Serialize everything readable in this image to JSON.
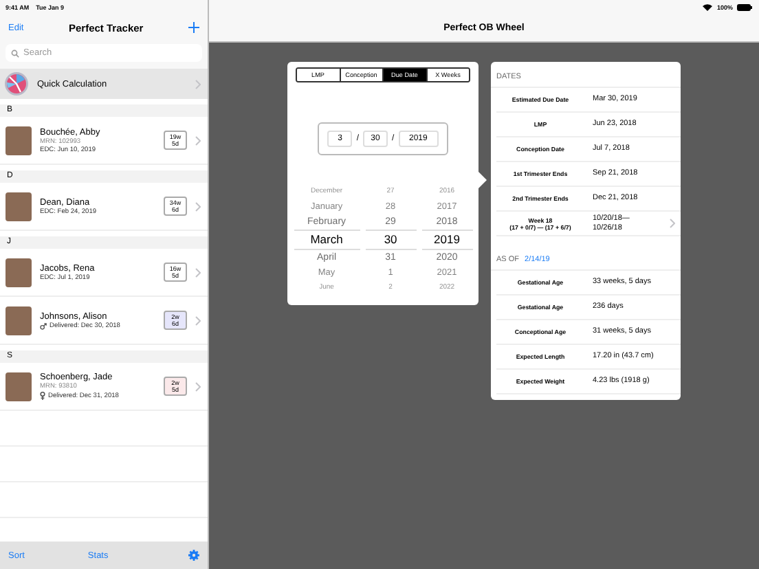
{
  "status_bar": {
    "time": "9:41 AM",
    "date": "Tue Jan 9",
    "battery": "100%"
  },
  "sidebar": {
    "edit": "Edit",
    "title": "Perfect Tracker",
    "search": {
      "placeholder": "Search"
    },
    "quick": {
      "label": "Quick Calculation",
      "selected": true
    },
    "sections": [
      {
        "letter": "B",
        "patients": [
          {
            "name": "Bouchée, Abby",
            "mrn": "MRN: 102993",
            "detail": "EDC: Jun 10, 2019",
            "kind": "edc",
            "badge": "19w\n5d",
            "color": "#ffffff"
          }
        ]
      },
      {
        "letter": "D",
        "patients": [
          {
            "name": "Dean, Diana",
            "detail": "EDC: Feb 24, 2019",
            "kind": "edc",
            "badge": "34w\n6d",
            "color": "#ffffff"
          }
        ]
      },
      {
        "letter": "J",
        "patients": [
          {
            "name": "Jacobs, Rena",
            "detail": "EDC: Jul 1, 2019",
            "kind": "edc",
            "badge": "16w\n5d",
            "color": "#ffffff"
          },
          {
            "name": "Johnsons, Alison",
            "detail": "Delivered: Dec 30, 2018",
            "kind": "delivered-male",
            "badge": "2w\n6d",
            "color": "#e6e6fb"
          }
        ]
      },
      {
        "letter": "S",
        "patients": [
          {
            "name": "Schoenberg, Jade",
            "mrn": "MRN: 93810",
            "detail": "Delivered: Dec 31, 2018",
            "kind": "delivered-female",
            "badge": "2w\n5d",
            "color": "#fbe9ea"
          }
        ]
      }
    ],
    "toolbar": {
      "sort": "Sort",
      "stats": "Stats"
    }
  },
  "detail": {
    "title": "Perfect OB Wheel",
    "tabs": [
      {
        "label": "LMP",
        "selected": false
      },
      {
        "label": "Conception",
        "selected": false
      },
      {
        "label": "Due Date",
        "selected": true
      },
      {
        "label": "X Weeks",
        "selected": false
      }
    ],
    "date_fields": {
      "month": "3",
      "day": "30",
      "year": "2019",
      "separator": "/"
    },
    "wheel": [
      [
        {
          "text": "December",
          "selected": false
        },
        {
          "text": "January",
          "selected": false
        },
        {
          "text": "February",
          "selected": false
        },
        {
          "text": "March",
          "selected": true
        },
        {
          "text": "April",
          "selected": false
        },
        {
          "text": "May",
          "selected": false
        },
        {
          "text": "June",
          "selected": false
        }
      ],
      [
        {
          "text": "27",
          "selected": false
        },
        {
          "text": "28",
          "selected": false
        },
        {
          "text": "29",
          "selected": false
        },
        {
          "text": "30",
          "selected": true
        },
        {
          "text": "31",
          "selected": false
        },
        {
          "text": "1",
          "selected": false
        },
        {
          "text": "2",
          "selected": false
        }
      ],
      [
        {
          "text": "2016",
          "selected": false
        },
        {
          "text": "2017",
          "selected": false
        },
        {
          "text": "2018",
          "selected": false
        },
        {
          "text": "2019",
          "selected": true
        },
        {
          "text": "2020",
          "selected": false
        },
        {
          "text": "2021",
          "selected": false
        },
        {
          "text": "2022",
          "selected": false
        }
      ]
    ],
    "sections": [
      {
        "header": "DATES",
        "rows": [
          {
            "label": "Estimated Due Date",
            "value": "Mar 30, 2019",
            "kind": "plain"
          },
          {
            "label": "LMP",
            "value": "Jun 23, 2018",
            "kind": "plain"
          },
          {
            "label": "Conception Date",
            "value": "Jul 7, 2018",
            "kind": "plain"
          },
          {
            "label": "1st Trimester Ends",
            "value": "Sep 21, 2018",
            "kind": "plain"
          },
          {
            "label": "2nd Trimester Ends",
            "value": "Dec 21, 2018",
            "kind": "plain"
          },
          {
            "label": "Week 18\n(17 + 0/7) — (17 + 6/7)",
            "value": "10/20/18—\n10/26/18",
            "kind": "link"
          }
        ]
      },
      {
        "header": "AS OF",
        "header_link": "2/14/19",
        "rows": [
          {
            "label": "Gestational Age",
            "value": "33 weeks, 5 days",
            "kind": "plain"
          },
          {
            "label": "Gestational Age",
            "value": "236 days",
            "kind": "plain"
          },
          {
            "label": "Conceptional Age",
            "value": "31 weeks, 5 days",
            "kind": "plain"
          },
          {
            "label": "Expected Length",
            "value": "17.20 in (43.7 cm)",
            "kind": "plain"
          },
          {
            "label": "Expected Weight",
            "value": "4.23 lbs (1918 g)",
            "kind": "plain"
          }
        ]
      }
    ]
  }
}
